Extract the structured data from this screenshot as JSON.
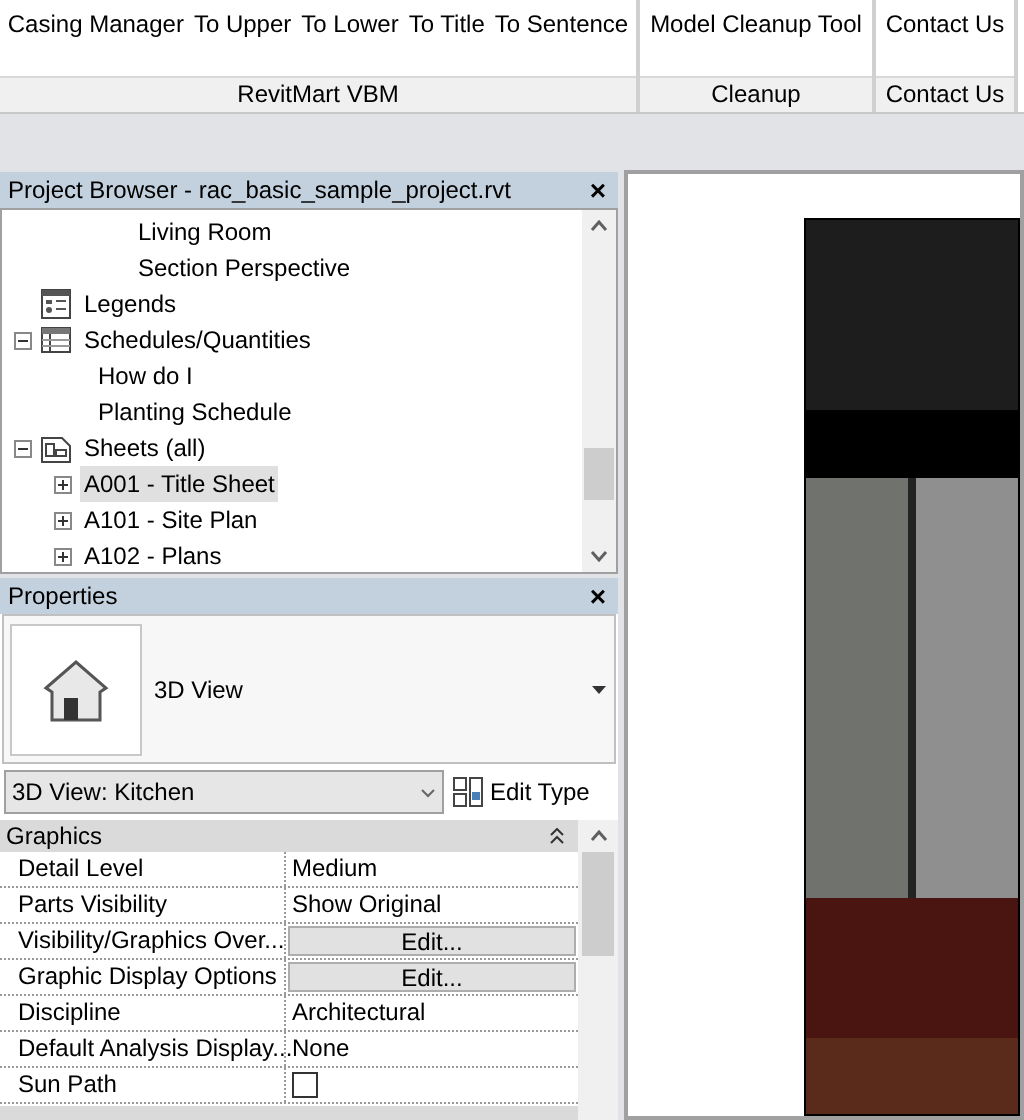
{
  "ribbon": {
    "panels": [
      {
        "label": "RevitMart VBM",
        "buttons": [
          "Casing Manager",
          "To Upper",
          "To Lower",
          "To Title",
          "To Sentence"
        ]
      },
      {
        "label": "Cleanup",
        "buttons": [
          "Model Cleanup Tool"
        ]
      },
      {
        "label": "Contact Us",
        "buttons": [
          "Contact Us"
        ]
      }
    ]
  },
  "project_browser": {
    "title": "Project Browser - rac_basic_sample_project.rvt",
    "close": "×",
    "continued_items": [
      {
        "label": "Living Room",
        "selected": false
      },
      {
        "label": "Section Perspective",
        "selected": false
      }
    ],
    "items": [
      {
        "label": "Legends",
        "selected": false
      },
      {
        "label": "Schedules/Quantities",
        "selected": false,
        "expanded": true,
        "children": [
          {
            "label": "How do I",
            "selected": false
          },
          {
            "label": "Planting Schedule",
            "selected": false
          }
        ]
      },
      {
        "label": "Sheets (all)",
        "selected": false,
        "expanded": true,
        "children": [
          {
            "label": "A001 - Title Sheet",
            "selected": true,
            "expanded": false
          },
          {
            "label": "A101 - Site Plan",
            "selected": false,
            "expanded": false
          },
          {
            "label": "A102 - Plans",
            "selected": false,
            "expanded": false
          }
        ]
      }
    ]
  },
  "properties": {
    "title": "Properties",
    "close": "×",
    "type_name": "3D View",
    "instance": "3D View: Kitchen",
    "edit_type": "Edit Type",
    "category": {
      "label": "Graphics",
      "expanded": true
    },
    "rows": [
      {
        "kind": "text",
        "name": "Detail Level",
        "value": "Medium"
      },
      {
        "kind": "text",
        "name": "Parts Visibility",
        "value": "Show Original"
      },
      {
        "kind": "button",
        "name": "Visibility/Graphics Over...",
        "value": "Edit..."
      },
      {
        "kind": "button",
        "name": "Graphic Display Options",
        "value": "Edit..."
      },
      {
        "kind": "text",
        "name": "Discipline",
        "value": "Architectural"
      },
      {
        "kind": "text",
        "name": "Default Analysis Display...",
        "value": "None"
      },
      {
        "kind": "checkbox",
        "name": "Sun Path",
        "checked": false
      }
    ]
  }
}
